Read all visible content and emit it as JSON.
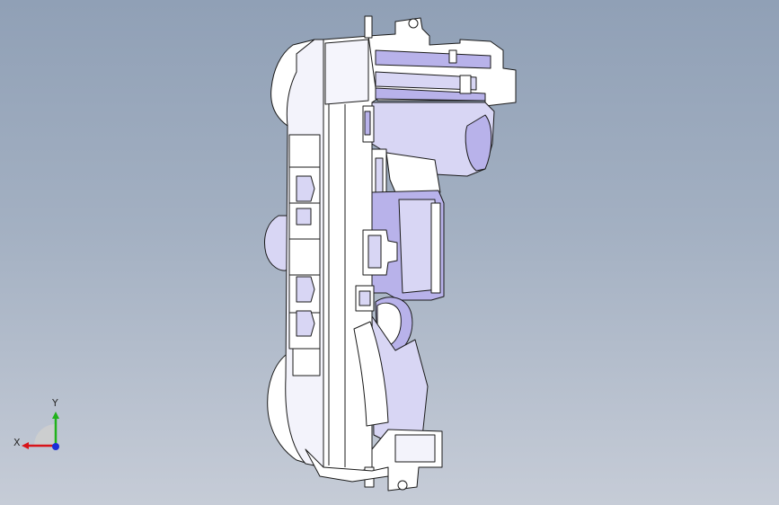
{
  "viewport": {
    "background_top": "#90a0b6",
    "background_bottom": "#c6ccd7"
  },
  "model": {
    "part_fill": "#ffffff",
    "part_shade": "#d8d6f4",
    "part_accent": "#b8b2ea",
    "edge_color": "#1a1a1a"
  },
  "triad": {
    "x_label": "X",
    "y_label": "Y",
    "x_color": "#d8141a",
    "y_color": "#21b21b",
    "z_color": "#1a2ed8"
  }
}
